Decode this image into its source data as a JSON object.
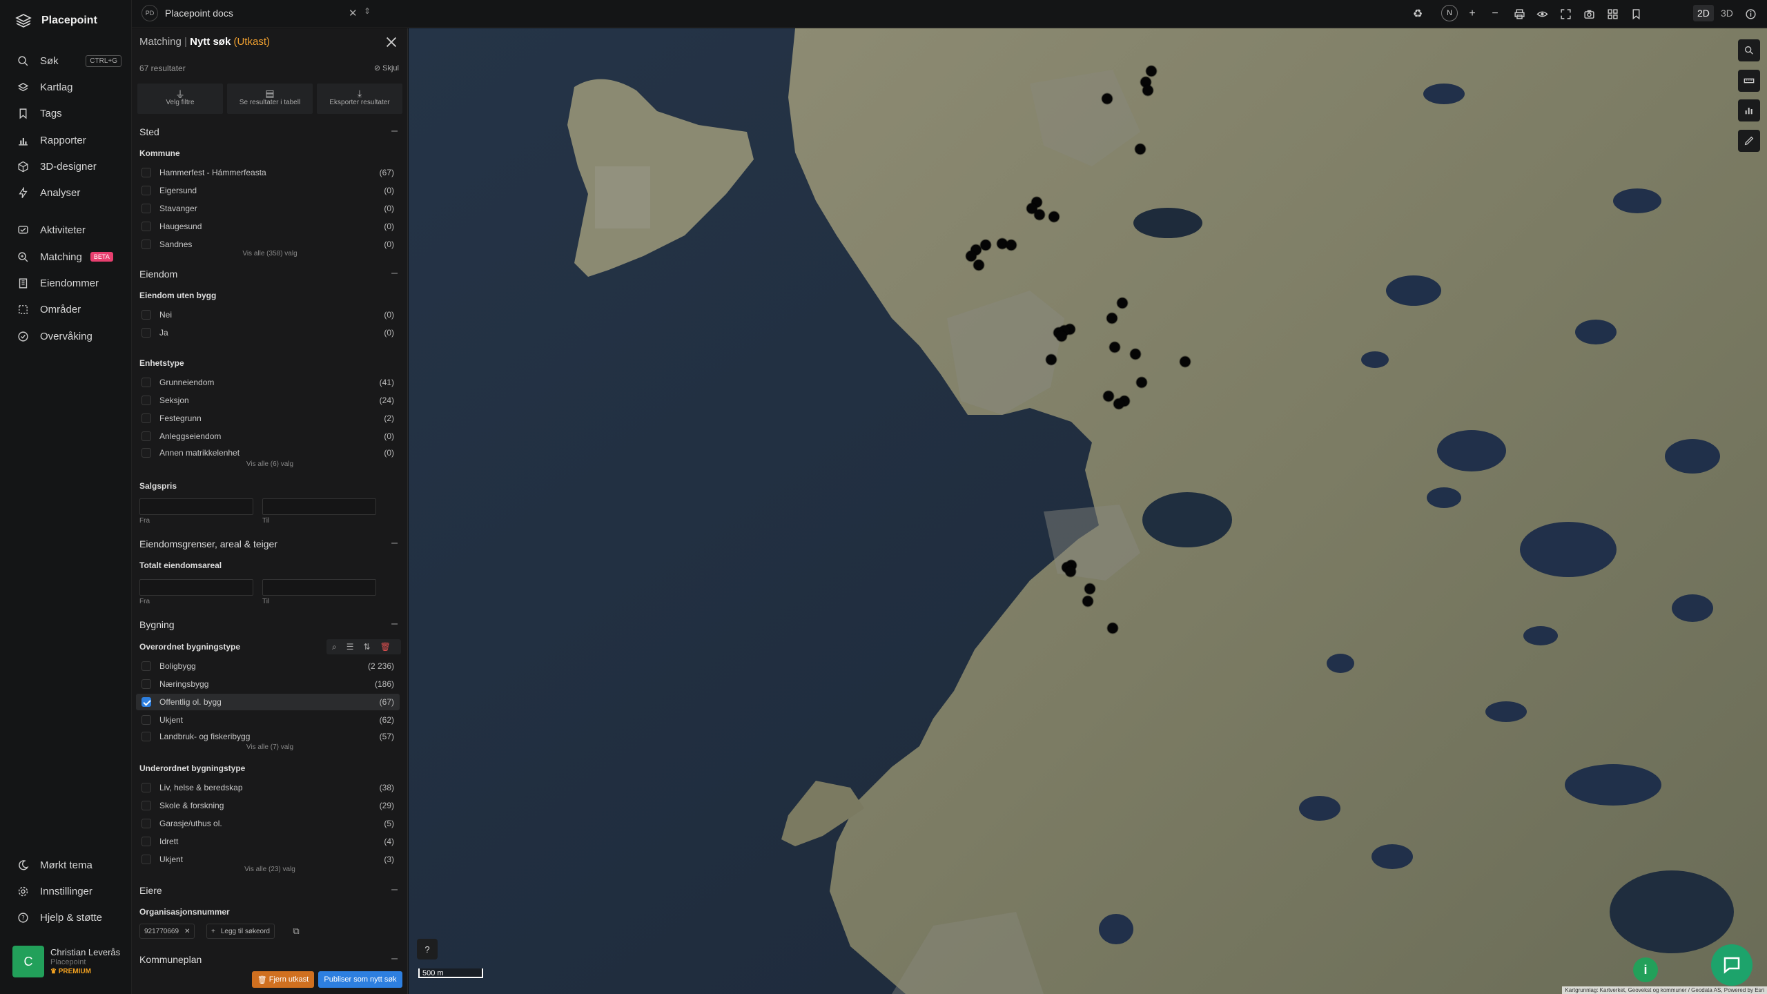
{
  "app": {
    "name": "Placepoint"
  },
  "nav": {
    "items": [
      {
        "label": "Søk",
        "shortcut": "CTRL+G"
      },
      {
        "label": "Kartlag"
      },
      {
        "label": "Tags"
      },
      {
        "label": "Rapporter"
      },
      {
        "label": "3D-designer"
      },
      {
        "label": "Analyser"
      },
      {
        "label": "Aktiviteter"
      },
      {
        "label": "Matching",
        "badge": "BETA"
      },
      {
        "label": "Eiendommer"
      },
      {
        "label": "Områder"
      },
      {
        "label": "Overvåking"
      }
    ],
    "bottom": [
      {
        "label": "Mørkt tema"
      },
      {
        "label": "Innstillinger"
      },
      {
        "label": "Hjelp & støtte"
      }
    ],
    "user": {
      "initial": "C",
      "name": "Christian Leverås",
      "org": "Placepoint",
      "plan": "PREMIUM"
    }
  },
  "topbar": {
    "workspace_badge": "PD",
    "workspace": "Placepoint docs",
    "view_2d": "2D",
    "view_3d": "3D",
    "compass": "N"
  },
  "panel": {
    "breadcrumb_root": "Matching",
    "breadcrumb_current": "Nytt søk",
    "draft_label": "(Utkast)",
    "result_count": "67 resultater",
    "hide_label": "Skjul",
    "actions": [
      {
        "label": "Velg filtre"
      },
      {
        "label": "Se resultater i tabell"
      },
      {
        "label": "Eksporter resultater"
      }
    ],
    "sted": {
      "title": "Sted",
      "kommune_label": "Kommune",
      "items": [
        {
          "label": "Hammerfest - Hámmerfeasta",
          "count": "(67)"
        },
        {
          "label": "Eigersund",
          "count": "(0)"
        },
        {
          "label": "Stavanger",
          "count": "(0)"
        },
        {
          "label": "Haugesund",
          "count": "(0)"
        },
        {
          "label": "Sandnes",
          "count": "(0)"
        }
      ],
      "show_all": "Vis alle (358) valg"
    },
    "eiendom": {
      "title": "Eiendom",
      "uten_bygg_label": "Eiendom uten bygg",
      "uten_bygg_items": [
        {
          "label": "Nei",
          "count": "(0)"
        },
        {
          "label": "Ja",
          "count": "(0)"
        }
      ],
      "enhetstype_label": "Enhetstype",
      "enhetstype_items": [
        {
          "label": "Grunneiendom",
          "count": "(41)"
        },
        {
          "label": "Seksjon",
          "count": "(24)"
        },
        {
          "label": "Festegrunn",
          "count": "(2)"
        },
        {
          "label": "Anleggseiendom",
          "count": "(0)"
        },
        {
          "label": "Annen matrikkelenhet",
          "count": "(0)"
        }
      ],
      "enhetstype_show_all": "Vis alle (6) valg",
      "salgspris_label": "Salgspris",
      "from_label": "Fra",
      "to_label": "Til"
    },
    "areal": {
      "title": "Eiendomsgrenser, areal & teiger",
      "total_label": "Totalt eiendomsareal",
      "from_label": "Fra",
      "to_label": "Til"
    },
    "bygning": {
      "title": "Bygning",
      "overordnet_label": "Overordnet bygningstype",
      "overordnet_items": [
        {
          "label": "Boligbygg",
          "count": "(2 236)"
        },
        {
          "label": "Næringsbygg",
          "count": "(186)"
        },
        {
          "label": "Offentlig ol. bygg",
          "count": "(67)",
          "checked": true
        },
        {
          "label": "Ukjent",
          "count": "(62)"
        },
        {
          "label": "Landbruk- og fiskeribygg",
          "count": "(57)"
        }
      ],
      "overordnet_show_all": "Vis alle (7) valg",
      "underordnet_label": "Underordnet bygningstype",
      "underordnet_items": [
        {
          "label": "Liv, helse & beredskap",
          "count": "(38)"
        },
        {
          "label": "Skole & forskning",
          "count": "(29)"
        },
        {
          "label": "Garasje/uthus ol.",
          "count": "(5)"
        },
        {
          "label": "Idrett",
          "count": "(4)"
        },
        {
          "label": "Ukjent",
          "count": "(3)"
        }
      ],
      "underordnet_show_all": "Vis alle (23) valg"
    },
    "eiere": {
      "title": "Eiere",
      "org_label": "Organisasjonsnummer",
      "org_value": "921770669",
      "add_keyword": "Legg til søkeord"
    },
    "kommuneplan": {
      "title": "Kommuneplan"
    },
    "remove_draft": "Fjern utkast",
    "publish": "Publiser som nytt søk"
  },
  "map": {
    "scale_label": "500 m",
    "help": "?",
    "attribution": "Kartgrunnlag: Kartverket, Geovekst og kommuner / Geodata AS, Powered by Esri"
  },
  "colors": {
    "accent": "#2d7fe0",
    "draft": "#f0a030",
    "success": "#1da36b",
    "beta": "#e83f6f"
  }
}
